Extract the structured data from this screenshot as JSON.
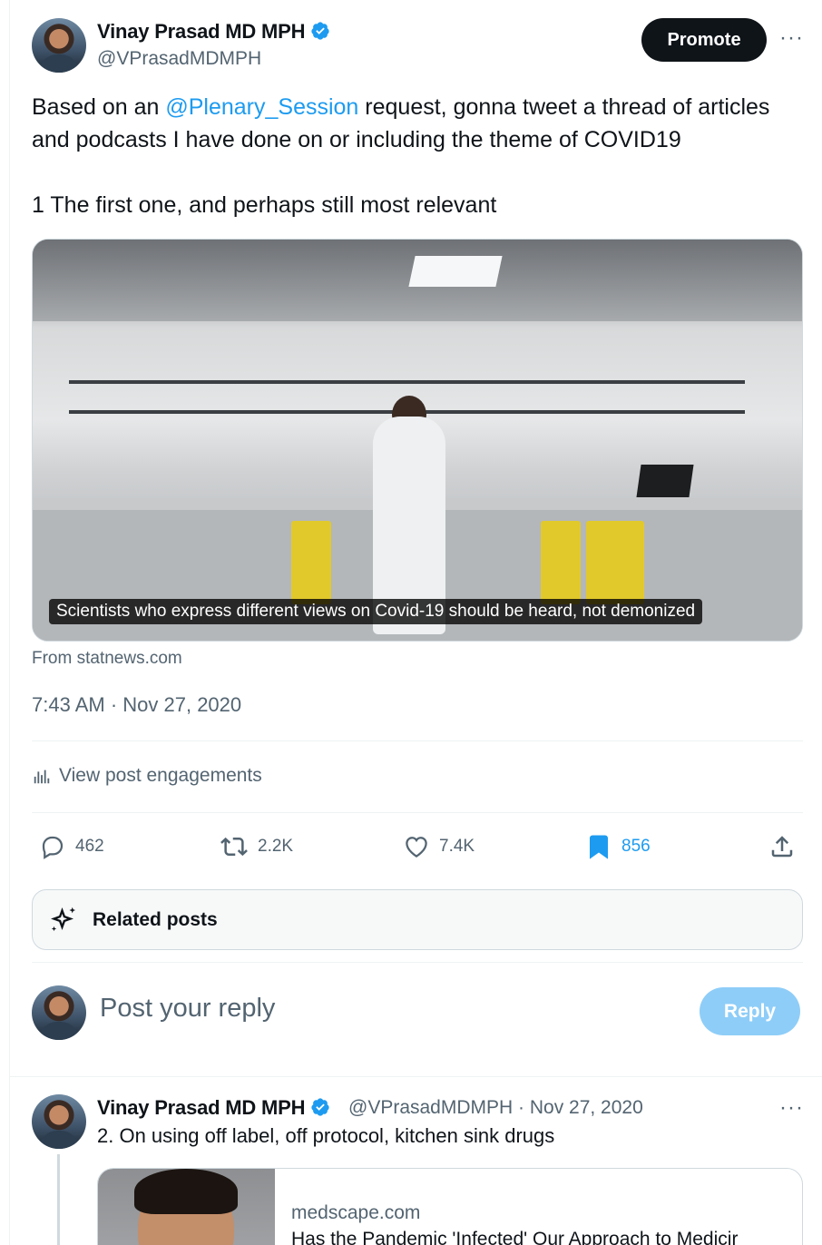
{
  "main_post": {
    "author_name": "Vinay Prasad MD MPH",
    "author_handle": "@VPrasadMDMPH",
    "promote_label": "Promote",
    "more_label": "···",
    "text_prefix": "Based on an ",
    "mention": "@Plenary_Session",
    "text_suffix": " request, gonna tweet a thread of articles and podcasts I have done on or including the theme of COVID19",
    "text_line2": "1 The first one, and perhaps still most relevant",
    "media_caption": "Scientists who express different views on Covid-19 should be heard, not demonized",
    "source": "From statnews.com",
    "timestamp": "7:43 AM · Nov 27, 2020",
    "engagements_label": "View post engagements",
    "actions": {
      "replies": "462",
      "reposts": "2.2K",
      "likes": "7.4K",
      "bookmarks": "856"
    },
    "related_label": "Related posts"
  },
  "reply_box": {
    "placeholder": "Post your reply",
    "button_label": "Reply"
  },
  "thread_reply": {
    "author_name": "Vinay Prasad MD MPH",
    "meta": "@VPrasadMDMPH · Nov 27, 2020",
    "more_label": "···",
    "text": "2. On using off label, off protocol, kitchen sink drugs",
    "card_domain": "medscape.com",
    "card_title": "Has the Pandemic 'Infected' Our Approach to Medicir"
  },
  "colors": {
    "accent": "#1d9bf0",
    "secondary_text": "#536471",
    "reply_button": "#8ecdf8"
  }
}
